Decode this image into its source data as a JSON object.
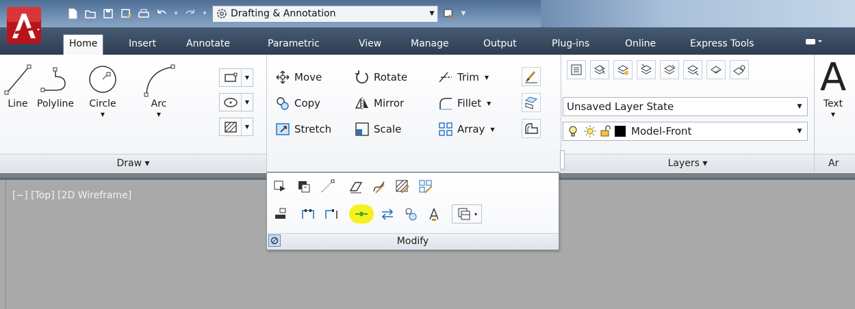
{
  "qat": {
    "workspace": "Drafting & Annotation"
  },
  "tabs": [
    {
      "label": "Home",
      "active": true
    },
    {
      "label": "Insert"
    },
    {
      "label": "Annotate"
    },
    {
      "label": "Parametric"
    },
    {
      "label": "View"
    },
    {
      "label": "Manage"
    },
    {
      "label": "Output"
    },
    {
      "label": "Plug-ins"
    },
    {
      "label": "Online"
    },
    {
      "label": "Express Tools"
    }
  ],
  "draw": {
    "title": "Draw ▾",
    "line": "Line",
    "polyline": "Polyline",
    "circle": "Circle",
    "arc": "Arc"
  },
  "modify": {
    "move": "Move",
    "rotate": "Rotate",
    "trim": "Trim",
    "copy": "Copy",
    "mirror": "Mirror",
    "fillet": "Fillet",
    "stretch": "Stretch",
    "scale": "Scale",
    "array": "Array",
    "title": "Modify"
  },
  "layers": {
    "state": "Unsaved Layer State",
    "current": "Model-Front",
    "title": "Layers ▾"
  },
  "annotation": {
    "text": "Text",
    "title_partial": "Ar"
  },
  "viewport": {
    "label": "[−] [Top] [2D Wireframe]"
  },
  "colors": {
    "highlight": "#f6f21f",
    "accent": "#0a8f2a"
  }
}
